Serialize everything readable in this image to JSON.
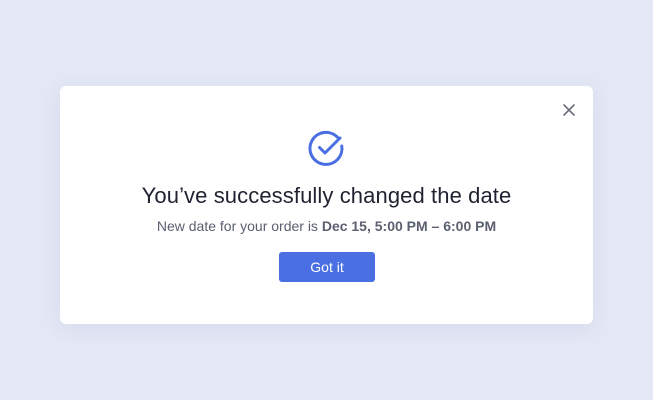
{
  "dialog": {
    "title": "You’ve successfully changed the date",
    "message_prefix": "New date for your order is ",
    "message_highlight": "Dec 15, 5:00 PM – 6:00 PM",
    "primary_button_label": "Got it",
    "close_icon": "close-icon",
    "status_icon": "check-circle-icon"
  },
  "colors": {
    "page_background": "#e4e8f5",
    "accent": "#4a6fe3",
    "title_text": "#1f2230",
    "body_text": "#5b6070",
    "close_icon": "#6b6f7a"
  }
}
